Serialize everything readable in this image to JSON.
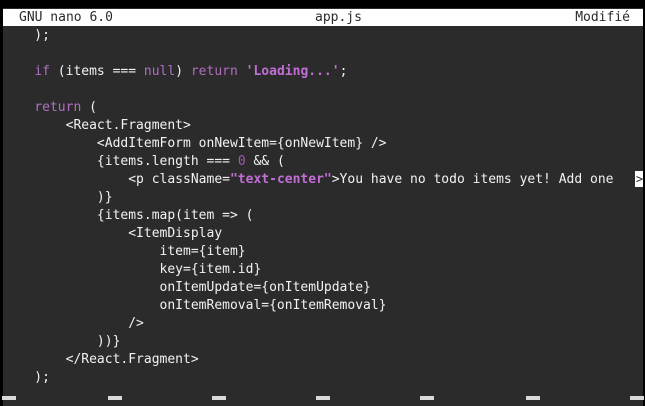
{
  "titlebar": {
    "app": "GNU nano 6.0",
    "filename": "app.js",
    "status": "Modifié"
  },
  "code": {
    "l1": "    );",
    "l3_if": "if",
    "l3_a": " (items === ",
    "l3_null": "null",
    "l3_b": ") ",
    "l3_return": "return",
    "l3_sp": " ",
    "l3_str": "'Loading...'",
    "l3_end": ";",
    "l5_return": "return",
    "l5_end": " (",
    "l6": "        <React.Fragment>",
    "l7": "            <AddItemForm onNewItem={onNewItem} />",
    "l8_a": "            {items.length === ",
    "l8_num": "0",
    "l8_b": " && (",
    "l9_a": "                <p className=",
    "l9_str": "\"text-center\"",
    "l9_b": ">You have no todo items yet! Add one ",
    "l9_cursor": ">",
    "l10": "            )}",
    "l11": "            {items.map(item => (",
    "l12": "                <ItemDisplay",
    "l13": "                    item={item}",
    "l14": "                    key={item.id}",
    "l15": "                    onItemUpdate={onItemUpdate}",
    "l16": "                    onItemRemoval={onItemRemoval}",
    "l17": "                />",
    "l18": "            ))}",
    "l19": "        </React.Fragment>",
    "l20": "    );"
  }
}
